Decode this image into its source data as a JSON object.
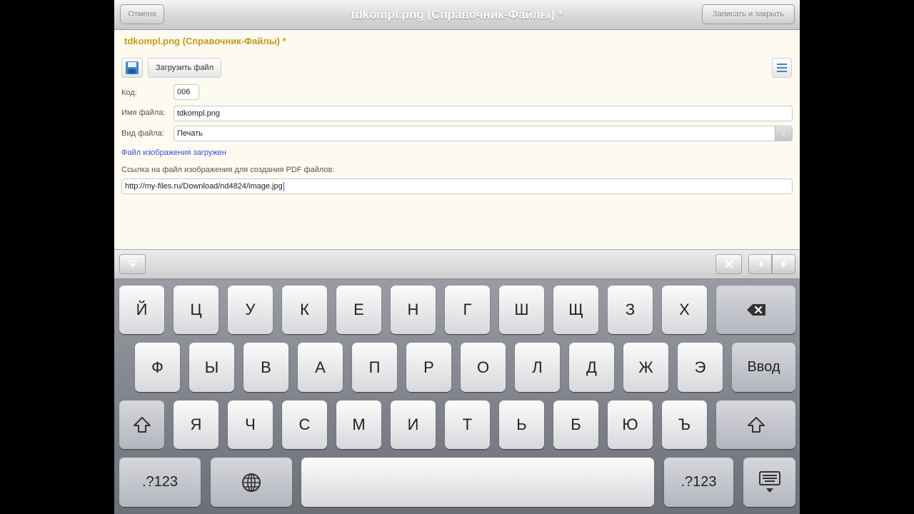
{
  "nav": {
    "cancel_label": "Отмена",
    "title": "tdkompl.png (Справочник-Файлы) *",
    "save_close_label": "Записать и закрыть"
  },
  "form": {
    "heading": "tdkompl.png (Справочник-Файлы) *",
    "toolbar": {
      "upload_label": "Загрузить файл"
    },
    "code_label": "Код:",
    "code_value": "006",
    "name_label": "Имя файла:",
    "name_value": "tdkompl.png",
    "type_label": "Вид файла:",
    "type_value": "Печать",
    "uploaded_text": "Файл изображения загружен",
    "pdf_link_label": "Ссылка на файл изображения для создания PDF файлов:",
    "url_value": "http://my-files.ru/Download/nd4824/image.jpg"
  },
  "accessory": {
    "hide_icon": "hide-keyboard-icon",
    "clear_icon": "clear-icon",
    "prev_icon": "chevron-left-icon",
    "next_icon": "chevron-right-icon"
  },
  "keyboard": {
    "row1": [
      "Й",
      "Ц",
      "У",
      "К",
      "Е",
      "Н",
      "Г",
      "Ш",
      "Щ",
      "З",
      "Х"
    ],
    "row2": [
      "Ф",
      "Ы",
      "В",
      "А",
      "П",
      "Р",
      "О",
      "Л",
      "Д",
      "Ж",
      "Э"
    ],
    "enter_label": "Ввод",
    "row3": [
      "Я",
      "Ч",
      "С",
      "М",
      "И",
      "Т",
      "Ь",
      "Б",
      "Ю",
      "Ъ"
    ],
    "numbers_label": ".?123",
    "icons": {
      "backspace": "backspace-icon",
      "shift": "shift-icon",
      "globe": "globe-icon",
      "dismiss": "keyboard-dismiss-icon"
    }
  },
  "colors": {
    "heading": "#c49a1c",
    "link": "#3a4fd6",
    "background": "#fdfbf0"
  }
}
